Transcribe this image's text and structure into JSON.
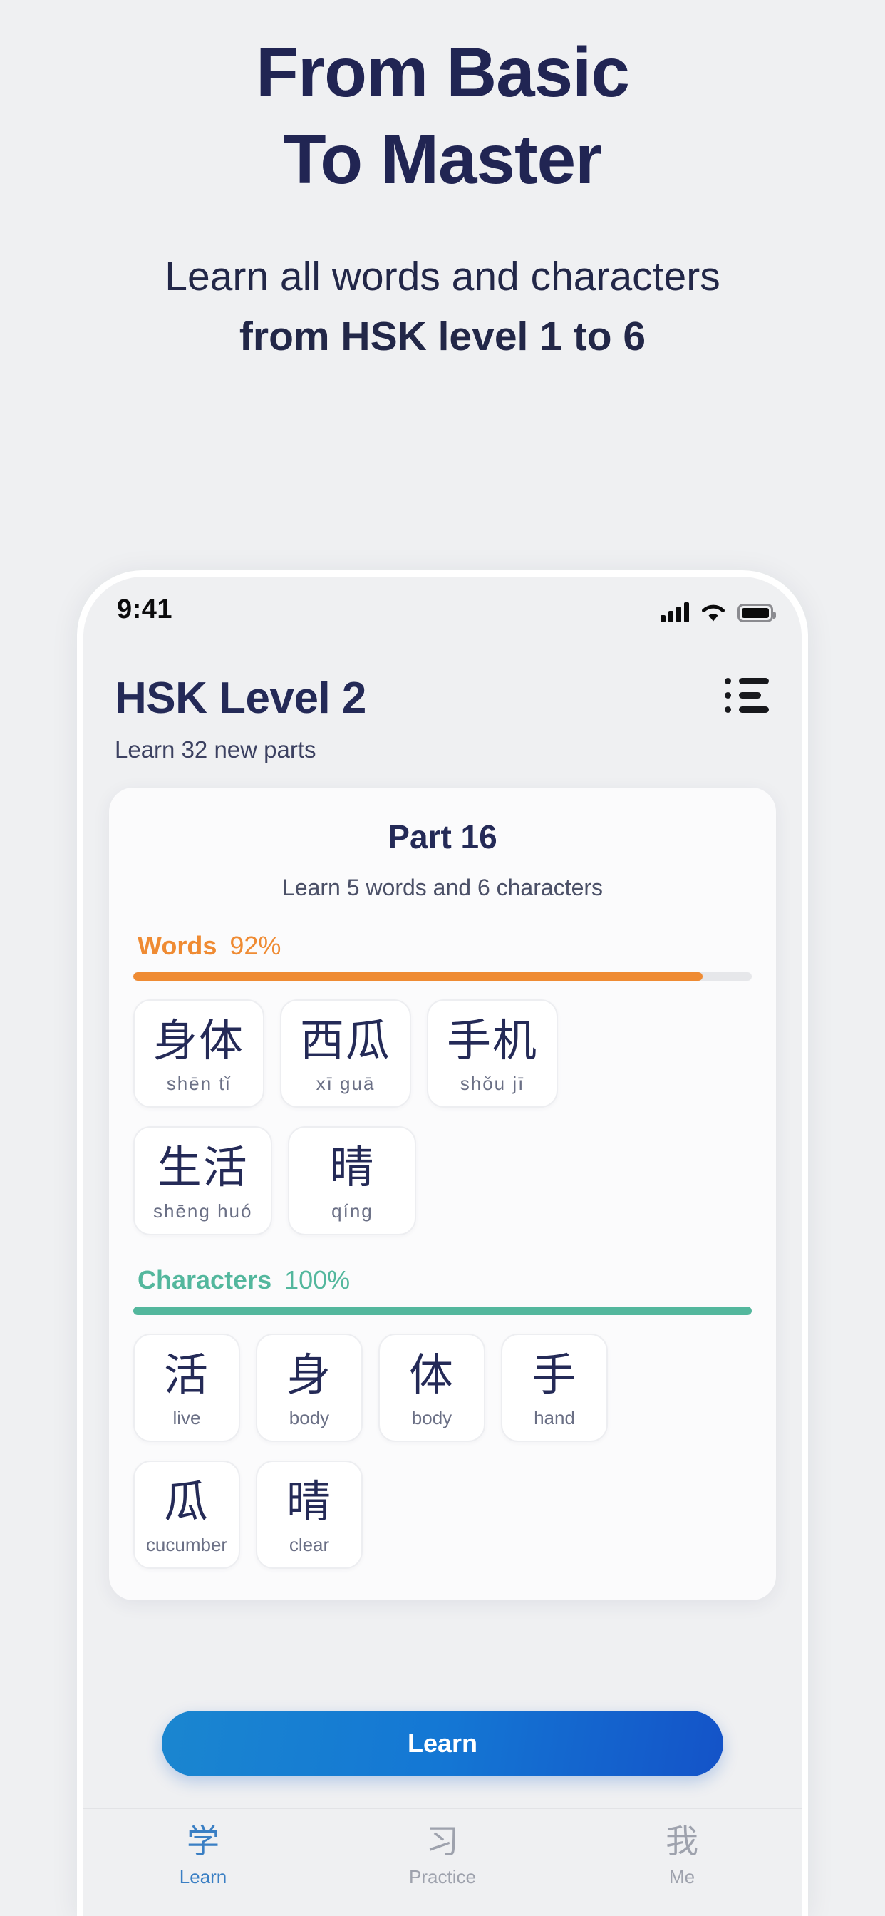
{
  "promo": {
    "title_line1": "From Basic",
    "title_line2": "To Master",
    "subtitle_line1": "Learn all words and characters",
    "subtitle_line2": "from HSK level 1 to 6",
    "title_color": "#212553"
  },
  "status_bar": {
    "time": "9:41",
    "signal_icon": "cellular-signal-icon",
    "wifi_icon": "wifi-icon",
    "battery_icon": "battery-full-icon"
  },
  "app_header": {
    "title": "HSK Level 2",
    "subtitle": "Learn 32 new parts",
    "menu_icon": "list-menu-icon"
  },
  "part_card": {
    "title": "Part 16",
    "subtitle": "Learn 5 words and 6 characters"
  },
  "words_section": {
    "label": "Words",
    "percent_label": "92%",
    "percent_value": 92,
    "color": "#ef8b33",
    "items": [
      {
        "hanzi": "身体",
        "pinyin": "shēn  tǐ"
      },
      {
        "hanzi": "西瓜",
        "pinyin": "xī  guā"
      },
      {
        "hanzi": "手机",
        "pinyin": "shǒu  jī"
      },
      {
        "hanzi": "生活",
        "pinyin": "shēng huó"
      },
      {
        "hanzi": "晴",
        "pinyin": "qíng"
      }
    ]
  },
  "characters_section": {
    "label": "Characters",
    "percent_label": "100%",
    "percent_value": 100,
    "color": "#53b79d",
    "items": [
      {
        "hanzi": "活",
        "meaning": "live"
      },
      {
        "hanzi": "身",
        "meaning": "body"
      },
      {
        "hanzi": "体",
        "meaning": "body"
      },
      {
        "hanzi": "手",
        "meaning": "hand"
      },
      {
        "hanzi": "瓜",
        "meaning": "cucumber"
      },
      {
        "hanzi": "晴",
        "meaning": "clear"
      }
    ]
  },
  "primary_button": {
    "label": "Learn",
    "color": "#1477d4"
  },
  "tab_bar": {
    "tabs": [
      {
        "glyph": "学",
        "label": "Learn",
        "active": true
      },
      {
        "glyph": "习",
        "label": "Practice",
        "active": false
      },
      {
        "glyph": "我",
        "label": "Me",
        "active": false
      }
    ],
    "active_color": "#3a7fc4",
    "inactive_color": "#9ea2ad"
  }
}
